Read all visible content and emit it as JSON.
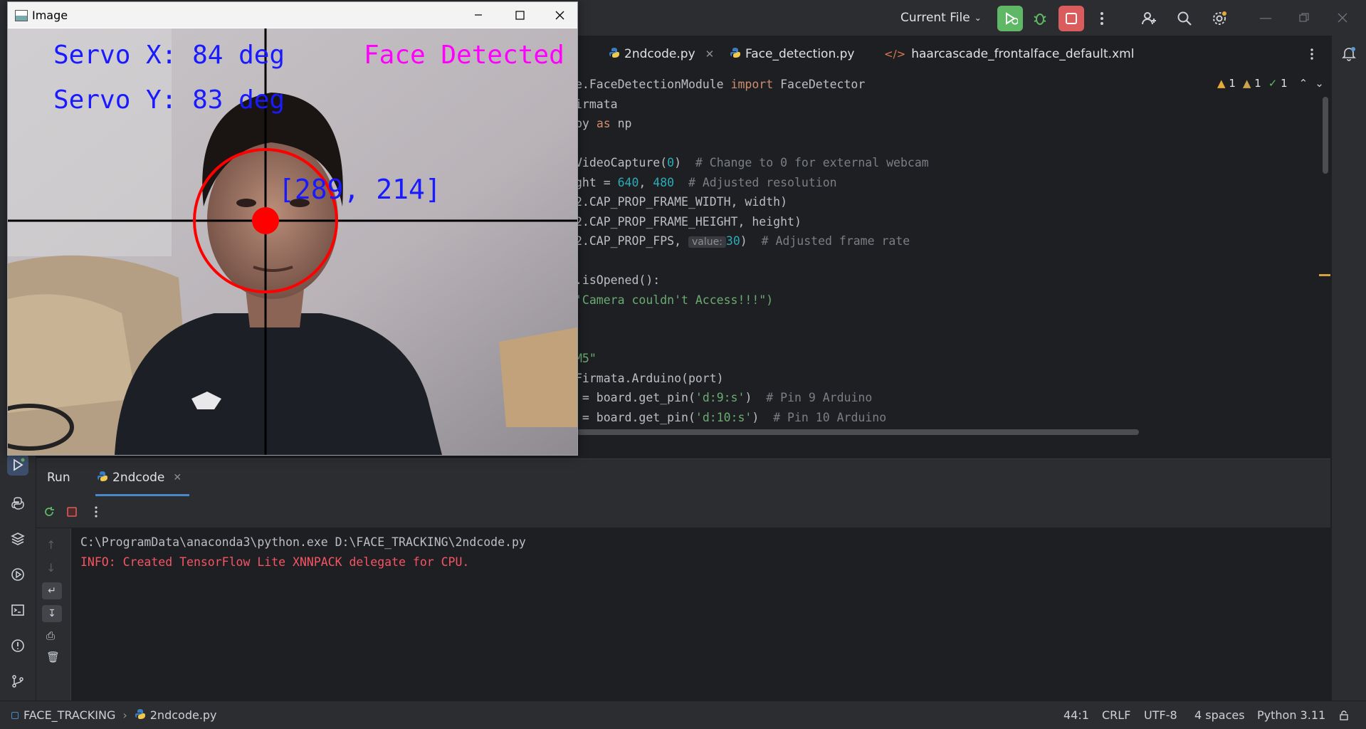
{
  "toolbar": {
    "run_config_label": "Current File",
    "icons": [
      "run-icon",
      "debug-icon",
      "stop-icon",
      "more-icon",
      "add-user-icon",
      "search-icon",
      "settings-icon"
    ]
  },
  "window_controls": [
    "minimize",
    "maximize",
    "close"
  ],
  "editor": {
    "tabs": [
      {
        "label": "2ndcode.py",
        "icon": "python-file-icon",
        "active": true
      },
      {
        "label": "Face_detection.py",
        "icon": "python-file-icon",
        "active": false
      },
      {
        "label": "haarcascade_frontalface_default.xml",
        "icon": "xml-file-icon",
        "active": false
      }
    ],
    "inspections": {
      "warnings": "1",
      "weak_warnings": "1",
      "ok": "1"
    },
    "lines": [
      {
        "parts": [
          [
            "",
            "e.FaceDetectionModule "
          ],
          [
            "kw",
            "import"
          ],
          [
            "",
            " FaceDetector"
          ]
        ]
      },
      {
        "parts": [
          [
            "",
            "irmata"
          ]
        ]
      },
      {
        "parts": [
          [
            "",
            "py "
          ],
          [
            "kw",
            "as"
          ],
          [
            "",
            " np"
          ]
        ]
      },
      {
        "parts": []
      },
      {
        "parts": [
          [
            "",
            "VideoCapture("
          ],
          [
            "num",
            "0"
          ],
          [
            "",
            ")  "
          ],
          [
            "cmt",
            "# Change to 0 for external webcam"
          ]
        ]
      },
      {
        "parts": [
          [
            "",
            "ght = "
          ],
          [
            "num",
            "640"
          ],
          [
            "",
            ", "
          ],
          [
            "num",
            "480"
          ],
          [
            "",
            "  "
          ],
          [
            "cmt",
            "# Adjusted resolution"
          ]
        ]
      },
      {
        "parts": [
          [
            "",
            "2.CAP_PROP_FRAME_WIDTH, width)"
          ]
        ]
      },
      {
        "parts": [
          [
            "",
            "2.CAP_PROP_FRAME_HEIGHT, height)"
          ]
        ]
      },
      {
        "parts": [
          [
            "",
            "2.CAP_PROP_FPS, "
          ],
          [
            "hint",
            "value:"
          ],
          [
            "num",
            "30"
          ],
          [
            "",
            ")  "
          ],
          [
            "cmt",
            "# Adjusted frame rate"
          ]
        ]
      },
      {
        "parts": []
      },
      {
        "parts": [
          [
            "",
            ".isOpened():"
          ]
        ]
      },
      {
        "parts": [
          [
            "str",
            "'Camera couldn't Access!!!\")"
          ]
        ]
      },
      {
        "parts": []
      },
      {
        "parts": []
      },
      {
        "parts": [
          [
            "str",
            "M5\""
          ]
        ]
      },
      {
        "parts": [
          [
            "",
            "Firmata.Arduino(port)"
          ]
        ]
      },
      {
        "parts": [
          [
            "",
            " = board.get_pin("
          ],
          [
            "str",
            "'d:9:s'"
          ],
          [
            "",
            ")  "
          ],
          [
            "cmt",
            "# Pin 9 Arduino"
          ]
        ]
      },
      {
        "parts": [
          [
            "",
            " = board.get_pin("
          ],
          [
            "str",
            "'d:10:s'"
          ],
          [
            "",
            ")  "
          ],
          [
            "cmt",
            "# Pin 10 Arduino"
          ]
        ]
      }
    ]
  },
  "run_panel": {
    "title": "Run",
    "tab_label": "2ndcode",
    "console": [
      {
        "text": "C:\\ProgramData\\anaconda3\\python.exe D:\\FACE_TRACKING\\2ndcode.py",
        "color": "#bcbec4"
      },
      {
        "text": "INFO: Created TensorFlow Lite XNNPACK delegate for CPU.",
        "color": "#f75464"
      }
    ]
  },
  "statusbar": {
    "project": "FACE_TRACKING",
    "file": "2ndcode.py",
    "position": "44:1",
    "line_sep": "CRLF",
    "encoding": "UTF-8",
    "indent": "4 spaces",
    "interpreter": "Python 3.11"
  },
  "image_window": {
    "title": "Image",
    "servo_x": "Servo X: 84 deg",
    "servo_y": "Servo Y: 83 deg",
    "face_status": "Face Detected",
    "face_coords": "[289, 214]"
  },
  "colors": {
    "accent": "#4a88c7",
    "run_green": "#5fb865",
    "stop_red": "#db5c5c",
    "overlay_blue": "#1a1aff",
    "overlay_magenta": "#ff00ff",
    "marker_red": "#ff0000"
  }
}
